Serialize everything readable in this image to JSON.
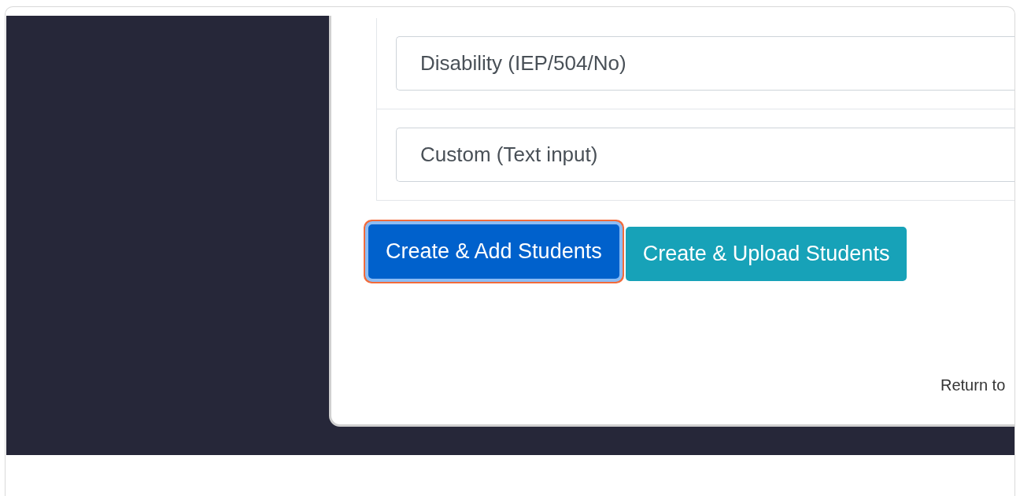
{
  "fields": [
    {
      "value": "Disability (IEP/504/No)"
    },
    {
      "value": "Custom (Text input)"
    }
  ],
  "buttons": [
    {
      "label": "Create & Add Students",
      "kind": "primary",
      "highlighted": true
    },
    {
      "label": "Create & Upload Students",
      "kind": "info",
      "highlighted": false
    }
  ],
  "footer": {
    "text": "Return to"
  }
}
